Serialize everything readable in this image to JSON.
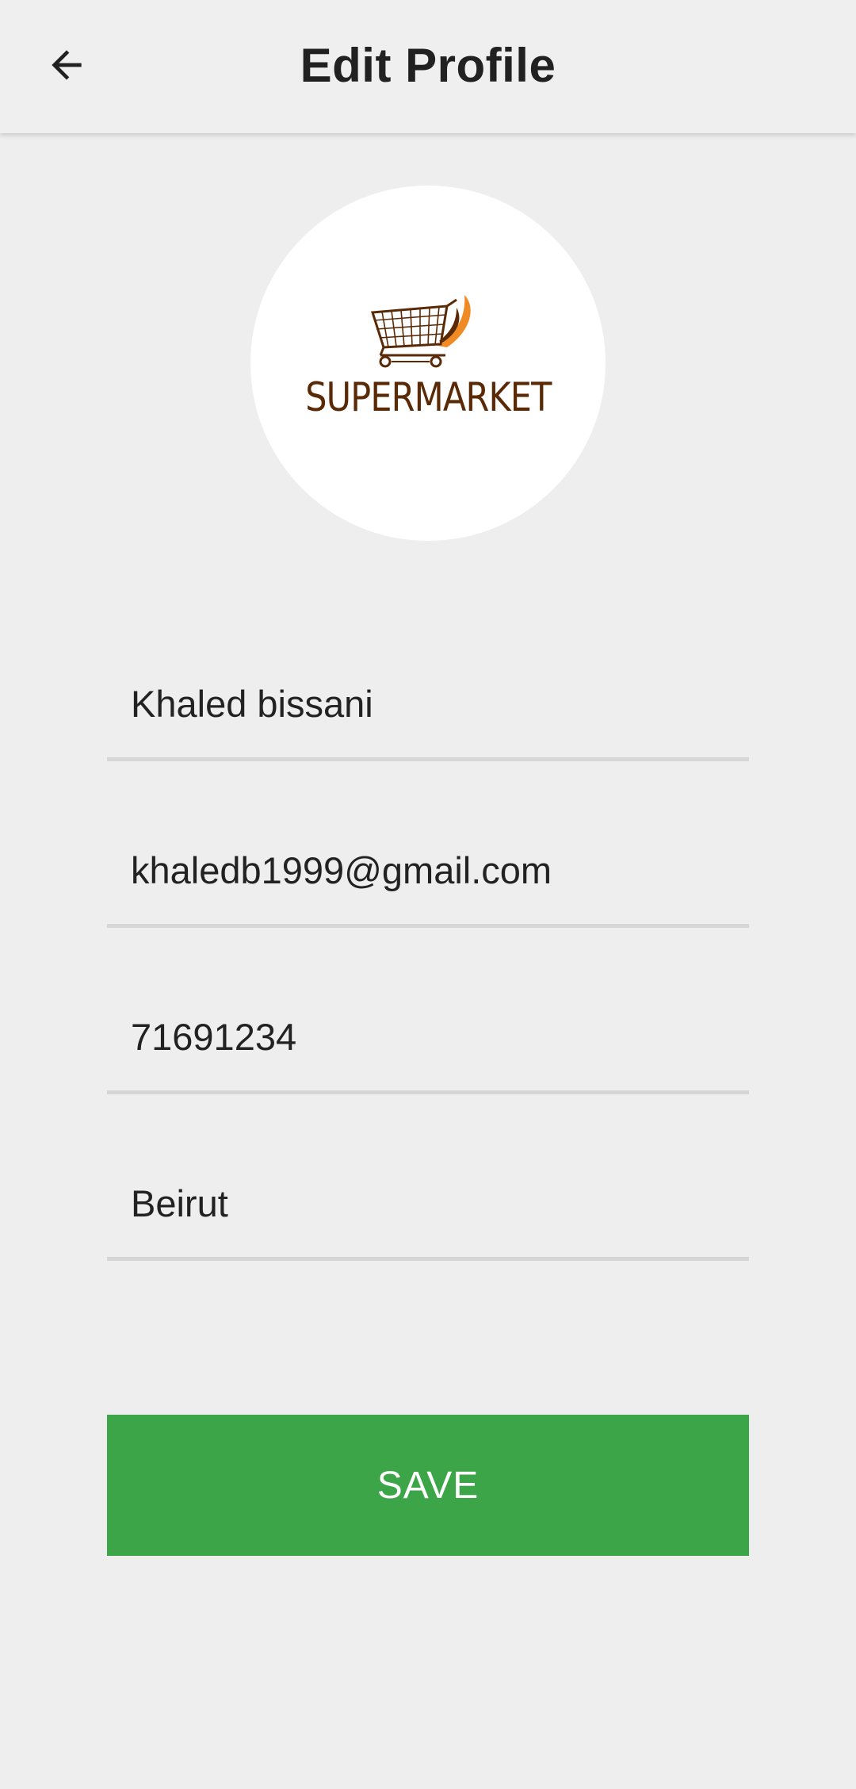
{
  "header": {
    "title": "Edit Profile",
    "back_icon": "arrow-left-icon"
  },
  "avatar": {
    "logo_text": "SUPERMARKET",
    "logo_icon": "shopping-cart-icon"
  },
  "form": {
    "name": {
      "value": "Khaled bissani"
    },
    "email": {
      "value": "khaledb1999@gmail.com"
    },
    "phone": {
      "value": "71691234"
    },
    "city": {
      "value": "Beirut"
    }
  },
  "actions": {
    "save_label": "SAVE"
  },
  "colors": {
    "accent": "#3ba548",
    "background": "#eeeeee",
    "logo_brown": "#5a2a06",
    "logo_orange": "#f08a24"
  }
}
